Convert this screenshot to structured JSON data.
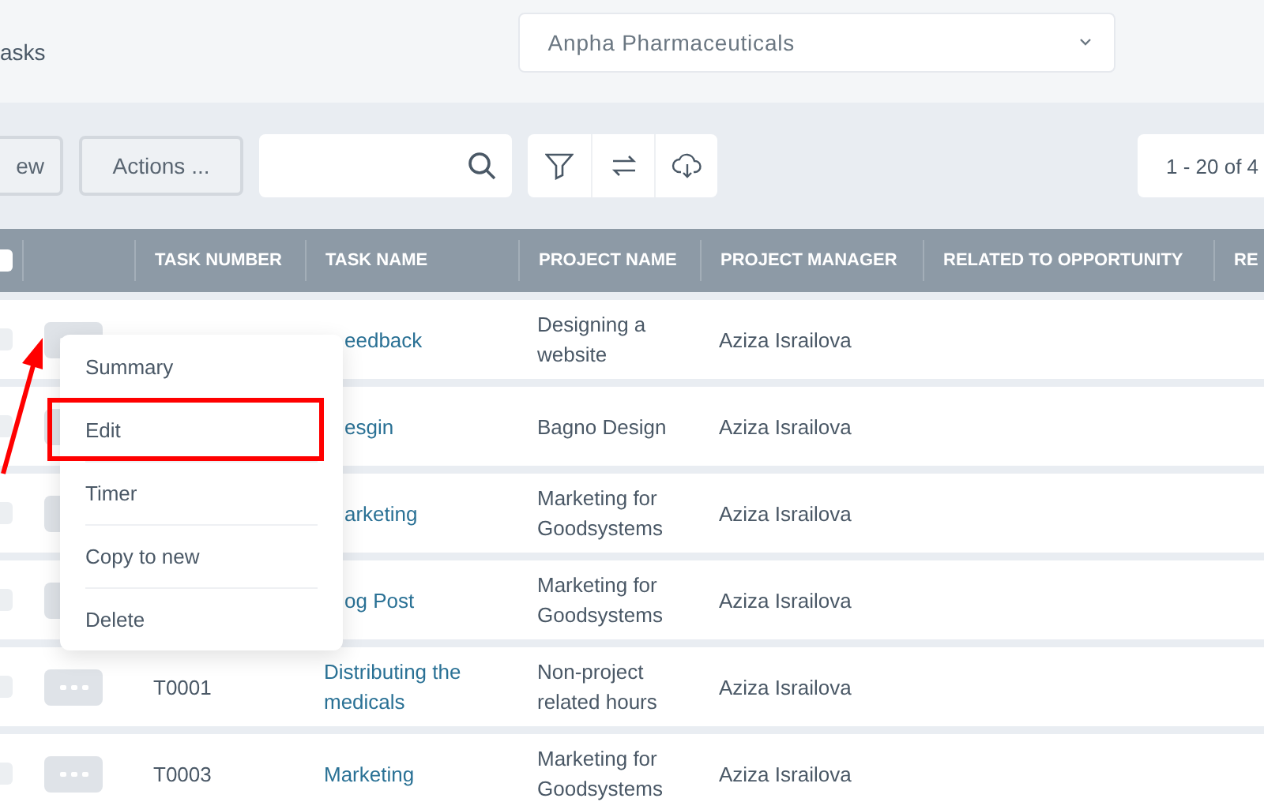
{
  "page_title": "asks",
  "company_select": {
    "value": "Anpha Pharmaceuticals"
  },
  "toolbar": {
    "new_button": "ew",
    "actions_button": "Actions ...",
    "pager": "1 - 20 of 4"
  },
  "table": {
    "select_all_checked": false,
    "columns": [
      "",
      "TASK NUMBER",
      "TASK NAME",
      "PROJECT NAME",
      "PROJECT MANAGER",
      "RELATED TO OPPORTUNITY",
      "RE"
    ],
    "rows": [
      {
        "checked": false,
        "task_number": "",
        "task_name": "eedback",
        "under_menu": true,
        "project_name": "Designing a website",
        "project_manager": "Aziza Israilova"
      },
      {
        "checked": false,
        "task_number": "",
        "task_name": "esgin",
        "under_menu": true,
        "project_name": "Bagno Design",
        "project_manager": "Aziza Israilova"
      },
      {
        "checked": false,
        "task_number": "",
        "task_name": "arketing",
        "under_menu": true,
        "project_name": "Marketing for Goodsystems",
        "project_manager": "Aziza Israilova"
      },
      {
        "checked": false,
        "task_number": "",
        "task_name": "og Post",
        "under_menu": true,
        "project_name": "Marketing for Goodsystems",
        "project_manager": "Aziza Israilova"
      },
      {
        "checked": false,
        "task_number": "T0001",
        "task_name": "Distributing the medicals",
        "under_menu": false,
        "project_name": "Non-project related hours",
        "project_manager": "Aziza Israilova"
      },
      {
        "checked": false,
        "task_number": "T0003",
        "task_name": "Marketing",
        "under_menu": false,
        "project_name": "Marketing for Goodsystems",
        "project_manager": "Aziza Israilova"
      }
    ]
  },
  "context_menu": {
    "items": [
      {
        "label": "Summary",
        "highlighted": false
      },
      {
        "label": "Edit",
        "highlighted": true
      },
      {
        "label": "Timer",
        "highlighted": false
      },
      {
        "label": "Copy to new",
        "highlighted": false
      },
      {
        "label": "Delete",
        "highlighted": false
      }
    ]
  }
}
